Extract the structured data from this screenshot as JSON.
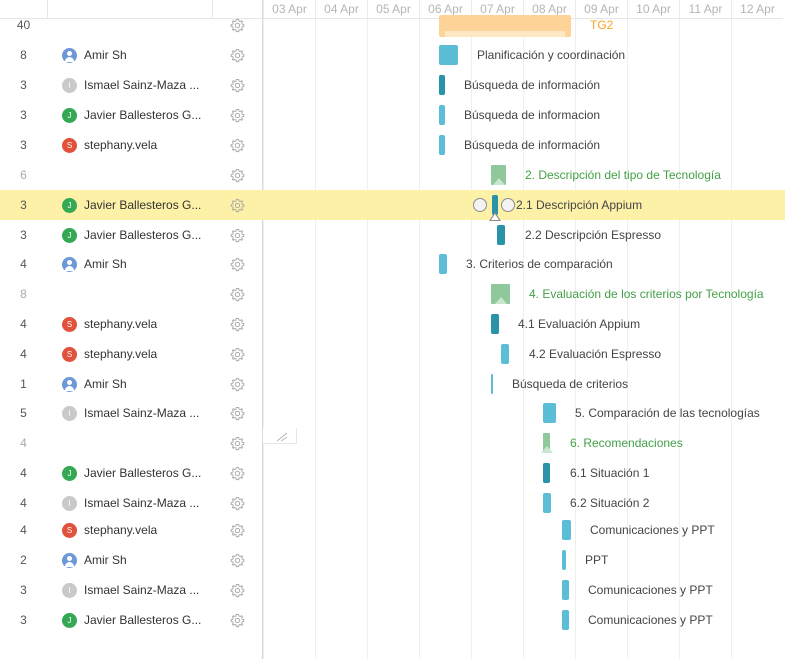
{
  "timeline": {
    "days": [
      "03 Apr",
      "04 Apr",
      "05 Apr",
      "06 Apr",
      "07 Apr",
      "08 Apr",
      "09 Apr",
      "10 Apr",
      "11 Apr",
      "12 Apr"
    ]
  },
  "rows": [
    {
      "count": "40",
      "assignee": "",
      "avatar": "",
      "task": "TG2",
      "kind": "project"
    },
    {
      "count": "8",
      "assignee": "Amir Sh",
      "avatar": "person",
      "task": "Planificación y coordinación",
      "kind": "task"
    },
    {
      "count": "3",
      "assignee": "Ismael Sainz-Maza ...",
      "avatar": "I",
      "task": "Búsqueda de información",
      "kind": "task"
    },
    {
      "count": "3",
      "assignee": "Javier Ballesteros G...",
      "avatar": "J",
      "task": "Búsqueda de informacion",
      "kind": "task"
    },
    {
      "count": "3",
      "assignee": "stephany.vela",
      "avatar": "S",
      "task": "Búsqueda de información",
      "kind": "task"
    },
    {
      "count": "6",
      "assignee": "",
      "avatar": "",
      "task": "2. Descripción del tipo de Tecnología",
      "kind": "parent"
    },
    {
      "count": "3",
      "assignee": "Javier Ballesteros G...",
      "avatar": "J",
      "task": "2.1 Descripción Appium",
      "kind": "task"
    },
    {
      "count": "3",
      "assignee": "Javier Ballesteros G...",
      "avatar": "J",
      "task": "2.2 Descripción Espresso",
      "kind": "task"
    },
    {
      "count": "4",
      "assignee": "Amir Sh",
      "avatar": "person",
      "task": "3. Criterios de comparación",
      "kind": "task"
    },
    {
      "count": "8",
      "assignee": "",
      "avatar": "",
      "task": "4. Evaluación de los criterios por Tecnología",
      "kind": "parent"
    },
    {
      "count": "4",
      "assignee": "stephany.vela",
      "avatar": "S",
      "task": "4.1 Evaluación Appium",
      "kind": "task"
    },
    {
      "count": "4",
      "assignee": "stephany.vela",
      "avatar": "S",
      "task": "4.2 Evaluación Espresso",
      "kind": "task"
    },
    {
      "count": "1",
      "assignee": "Amir Sh",
      "avatar": "person",
      "task": "Búsqueda de criterios",
      "kind": "task"
    },
    {
      "count": "5",
      "assignee": "Ismael Sainz-Maza ...",
      "avatar": "I",
      "task": "5. Comparación de las tecnologías",
      "kind": "task"
    },
    {
      "count": "4",
      "assignee": "",
      "avatar": "",
      "task": "6. Recomendaciones",
      "kind": "parent"
    },
    {
      "count": "4",
      "assignee": "Javier Ballesteros G...",
      "avatar": "J",
      "task": "6.1 Situación 1",
      "kind": "task"
    },
    {
      "count": "4",
      "assignee": "Ismael Sainz-Maza ...",
      "avatar": "I",
      "task": "6.2 Situación 2",
      "kind": "task"
    },
    {
      "count": "4",
      "assignee": "stephany.vela",
      "avatar": "S",
      "task": "Comunicaciones y PPT",
      "kind": "task"
    },
    {
      "count": "2",
      "assignee": "Amir Sh",
      "avatar": "person",
      "task": "PPT",
      "kind": "task"
    },
    {
      "count": "3",
      "assignee": "Ismael Sainz-Maza ...",
      "avatar": "I",
      "task": "Comunicaciones y PPT",
      "kind": "task"
    },
    {
      "count": "3",
      "assignee": "Javier Ballesteros G...",
      "avatar": "J",
      "task": "Comunicaciones y PPT",
      "kind": "task"
    }
  ],
  "colors": {
    "task_bar": "#5bbdd6",
    "task_bar_progress": "#2a93a8",
    "parent_bar": "#8fc99b",
    "project_bar": "#fdd397",
    "project_label": "#f5a623",
    "parent_label": "#43a047",
    "selected_row": "#fdf1a8"
  },
  "icons": {
    "row_action": "gear-icon",
    "resize": "resize-grip-icon",
    "person_avatar": "user-icon"
  }
}
